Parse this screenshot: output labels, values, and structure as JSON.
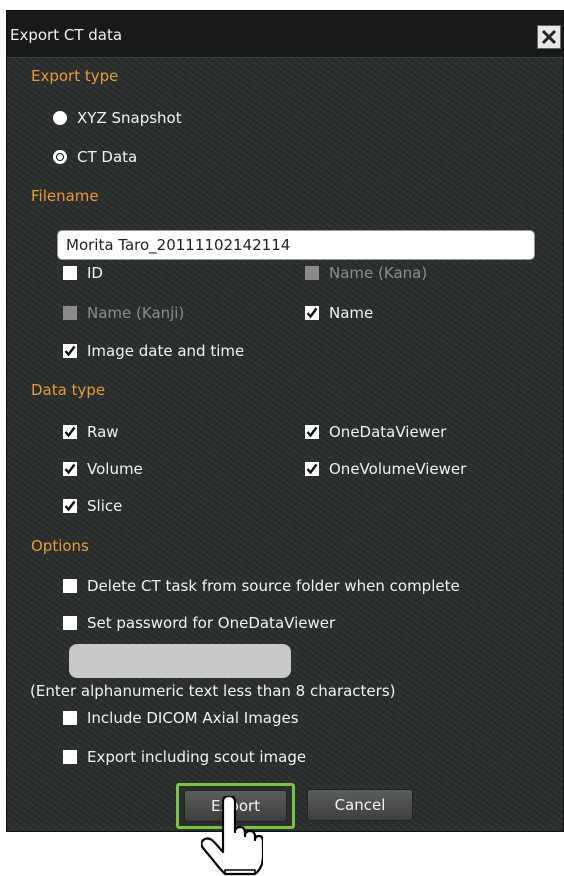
{
  "dialog": {
    "title": "Export CT data",
    "close_icon": "close-icon"
  },
  "export_type": {
    "heading": "Export type",
    "options": [
      {
        "label": "XYZ Snapshot",
        "selected": false
      },
      {
        "label": "CT Data",
        "selected": true
      }
    ]
  },
  "filename": {
    "heading": "Filename",
    "value": "Morita Taro_20111102142114",
    "fields": [
      {
        "label": "ID",
        "checked": false,
        "enabled": true
      },
      {
        "label": "Name (Kana)",
        "checked": false,
        "enabled": false
      },
      {
        "label": "Name (Kanji)",
        "checked": false,
        "enabled": false
      },
      {
        "label": "Name",
        "checked": true,
        "enabled": true
      },
      {
        "label": "Image date and time",
        "checked": true,
        "enabled": true
      }
    ]
  },
  "data_type": {
    "heading": "Data type",
    "items": [
      {
        "label": "Raw",
        "checked": true
      },
      {
        "label": "OneDataViewer",
        "checked": true
      },
      {
        "label": "Volume",
        "checked": true
      },
      {
        "label": "OneVolumeViewer",
        "checked": true
      },
      {
        "label": "Slice",
        "checked": true
      }
    ]
  },
  "options": {
    "heading": "Options",
    "delete_task": {
      "label": "Delete CT task from source folder when complete",
      "checked": false
    },
    "set_password": {
      "label": "Set password for OneDataViewer",
      "checked": false
    },
    "password_hint": "(Enter alphanumeric text less than 8 characters)",
    "dicom": {
      "label": "Include DICOM Axial Images",
      "checked": false
    },
    "scout": {
      "label": "Export including scout image",
      "checked": false
    }
  },
  "buttons": {
    "export": "Export",
    "cancel": "Cancel"
  },
  "colors": {
    "accent_heading": "#e89a3c",
    "focus_ring": "#7bc143",
    "background": "#2a2e2c"
  }
}
